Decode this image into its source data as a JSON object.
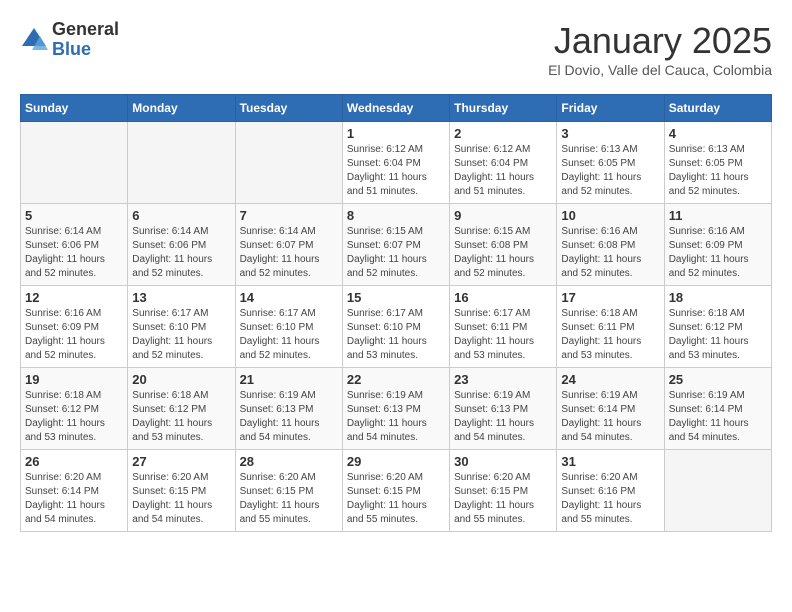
{
  "header": {
    "logo": {
      "general": "General",
      "blue": "Blue"
    },
    "title": "January 2025",
    "location": "El Dovio, Valle del Cauca, Colombia"
  },
  "calendar": {
    "days_of_week": [
      "Sunday",
      "Monday",
      "Tuesday",
      "Wednesday",
      "Thursday",
      "Friday",
      "Saturday"
    ],
    "weeks": [
      [
        null,
        null,
        null,
        {
          "day": 1,
          "sunrise": "6:12 AM",
          "sunset": "6:04 PM",
          "daylight": "11 hours and 51 minutes."
        },
        {
          "day": 2,
          "sunrise": "6:12 AM",
          "sunset": "6:04 PM",
          "daylight": "11 hours and 51 minutes."
        },
        {
          "day": 3,
          "sunrise": "6:13 AM",
          "sunset": "6:05 PM",
          "daylight": "11 hours and 52 minutes."
        },
        {
          "day": 4,
          "sunrise": "6:13 AM",
          "sunset": "6:05 PM",
          "daylight": "11 hours and 52 minutes."
        }
      ],
      [
        {
          "day": 5,
          "sunrise": "6:14 AM",
          "sunset": "6:06 PM",
          "daylight": "11 hours and 52 minutes."
        },
        {
          "day": 6,
          "sunrise": "6:14 AM",
          "sunset": "6:06 PM",
          "daylight": "11 hours and 52 minutes."
        },
        {
          "day": 7,
          "sunrise": "6:14 AM",
          "sunset": "6:07 PM",
          "daylight": "11 hours and 52 minutes."
        },
        {
          "day": 8,
          "sunrise": "6:15 AM",
          "sunset": "6:07 PM",
          "daylight": "11 hours and 52 minutes."
        },
        {
          "day": 9,
          "sunrise": "6:15 AM",
          "sunset": "6:08 PM",
          "daylight": "11 hours and 52 minutes."
        },
        {
          "day": 10,
          "sunrise": "6:16 AM",
          "sunset": "6:08 PM",
          "daylight": "11 hours and 52 minutes."
        },
        {
          "day": 11,
          "sunrise": "6:16 AM",
          "sunset": "6:09 PM",
          "daylight": "11 hours and 52 minutes."
        }
      ],
      [
        {
          "day": 12,
          "sunrise": "6:16 AM",
          "sunset": "6:09 PM",
          "daylight": "11 hours and 52 minutes."
        },
        {
          "day": 13,
          "sunrise": "6:17 AM",
          "sunset": "6:10 PM",
          "daylight": "11 hours and 52 minutes."
        },
        {
          "day": 14,
          "sunrise": "6:17 AM",
          "sunset": "6:10 PM",
          "daylight": "11 hours and 52 minutes."
        },
        {
          "day": 15,
          "sunrise": "6:17 AM",
          "sunset": "6:10 PM",
          "daylight": "11 hours and 53 minutes."
        },
        {
          "day": 16,
          "sunrise": "6:17 AM",
          "sunset": "6:11 PM",
          "daylight": "11 hours and 53 minutes."
        },
        {
          "day": 17,
          "sunrise": "6:18 AM",
          "sunset": "6:11 PM",
          "daylight": "11 hours and 53 minutes."
        },
        {
          "day": 18,
          "sunrise": "6:18 AM",
          "sunset": "6:12 PM",
          "daylight": "11 hours and 53 minutes."
        }
      ],
      [
        {
          "day": 19,
          "sunrise": "6:18 AM",
          "sunset": "6:12 PM",
          "daylight": "11 hours and 53 minutes."
        },
        {
          "day": 20,
          "sunrise": "6:18 AM",
          "sunset": "6:12 PM",
          "daylight": "11 hours and 53 minutes."
        },
        {
          "day": 21,
          "sunrise": "6:19 AM",
          "sunset": "6:13 PM",
          "daylight": "11 hours and 54 minutes."
        },
        {
          "day": 22,
          "sunrise": "6:19 AM",
          "sunset": "6:13 PM",
          "daylight": "11 hours and 54 minutes."
        },
        {
          "day": 23,
          "sunrise": "6:19 AM",
          "sunset": "6:13 PM",
          "daylight": "11 hours and 54 minutes."
        },
        {
          "day": 24,
          "sunrise": "6:19 AM",
          "sunset": "6:14 PM",
          "daylight": "11 hours and 54 minutes."
        },
        {
          "day": 25,
          "sunrise": "6:19 AM",
          "sunset": "6:14 PM",
          "daylight": "11 hours and 54 minutes."
        }
      ],
      [
        {
          "day": 26,
          "sunrise": "6:20 AM",
          "sunset": "6:14 PM",
          "daylight": "11 hours and 54 minutes."
        },
        {
          "day": 27,
          "sunrise": "6:20 AM",
          "sunset": "6:15 PM",
          "daylight": "11 hours and 54 minutes."
        },
        {
          "day": 28,
          "sunrise": "6:20 AM",
          "sunset": "6:15 PM",
          "daylight": "11 hours and 55 minutes."
        },
        {
          "day": 29,
          "sunrise": "6:20 AM",
          "sunset": "6:15 PM",
          "daylight": "11 hours and 55 minutes."
        },
        {
          "day": 30,
          "sunrise": "6:20 AM",
          "sunset": "6:15 PM",
          "daylight": "11 hours and 55 minutes."
        },
        {
          "day": 31,
          "sunrise": "6:20 AM",
          "sunset": "6:16 PM",
          "daylight": "11 hours and 55 minutes."
        },
        null
      ]
    ]
  }
}
